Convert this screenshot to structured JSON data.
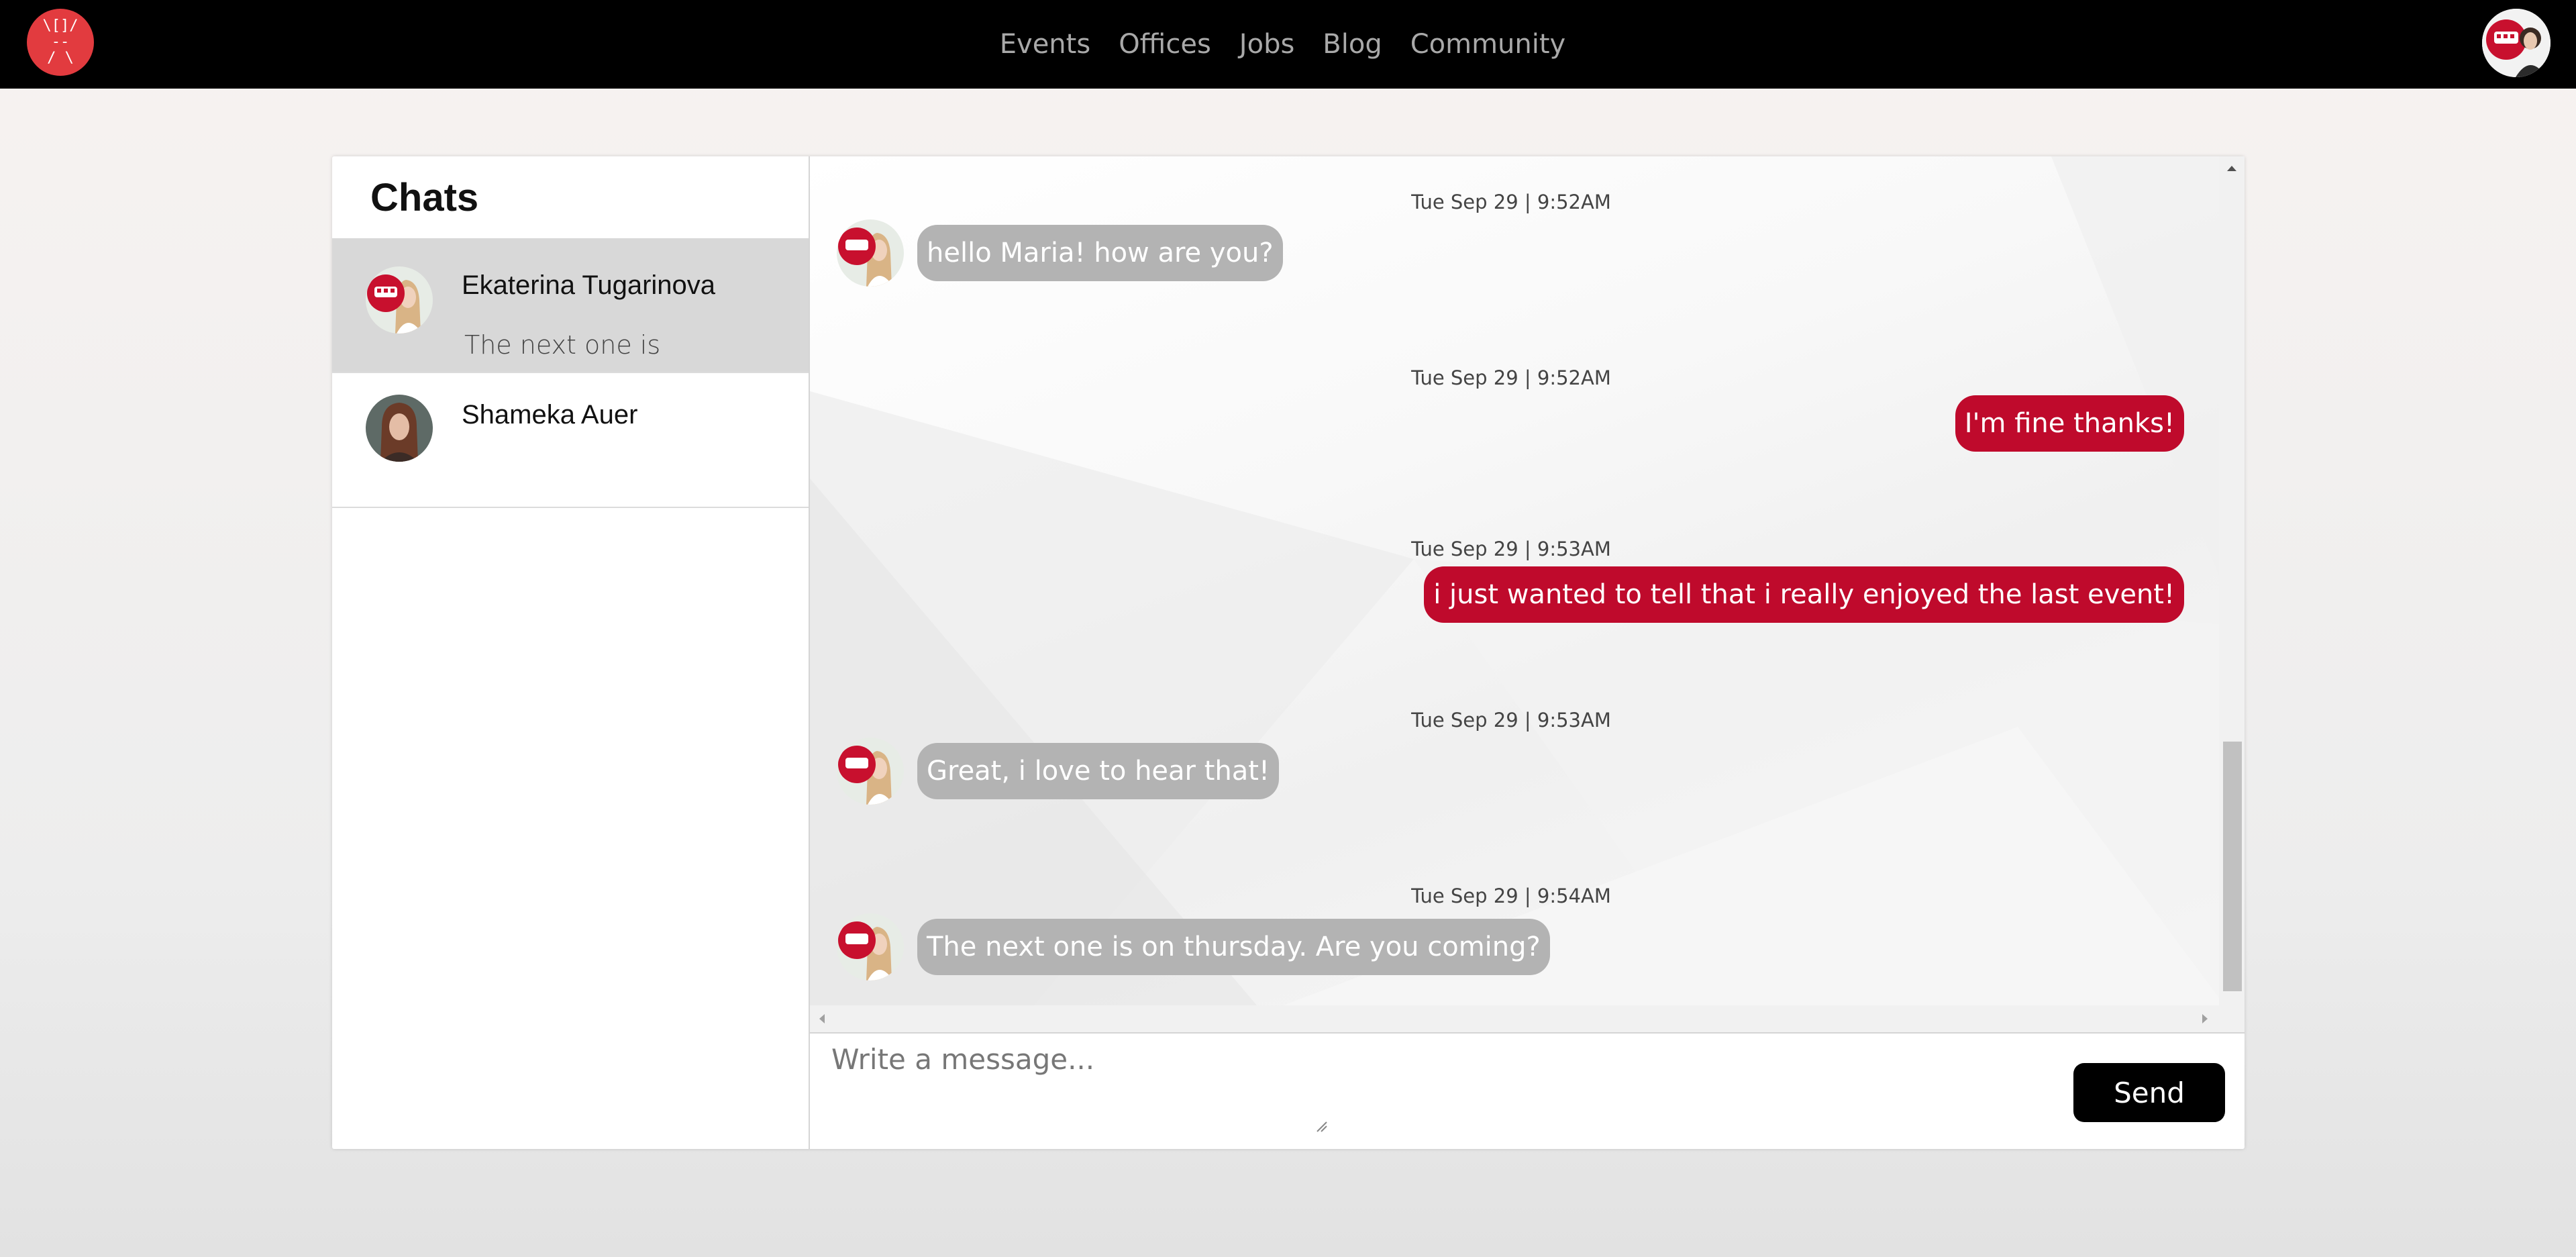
{
  "nav": {
    "logo_text": "\\[]/\n--\n/ \\",
    "links": [
      "Events",
      "Offices",
      "Jobs",
      "Blog",
      "Community"
    ]
  },
  "sidebar": {
    "title": "Chats",
    "contacts": [
      {
        "name": "Ekaterina Tugarinova",
        "preview": "The next one is",
        "active": true
      },
      {
        "name": "Shameka Auer",
        "preview": "",
        "active": false
      }
    ]
  },
  "messages": [
    {
      "time": "Tue Sep 29 | 9:52AM",
      "text": "hello Maria! how are you?",
      "direction": "in"
    },
    {
      "time": "Tue Sep 29 | 9:52AM",
      "text": "I'm fine thanks!",
      "direction": "out"
    },
    {
      "time": "Tue Sep 29 | 9:53AM",
      "text": "i just wanted to tell that i really enjoyed the last event!",
      "direction": "out"
    },
    {
      "time": "Tue Sep 29 | 9:53AM",
      "text": "Great, i love to hear that!",
      "direction": "in"
    },
    {
      "time": "Tue Sep 29 | 9:54AM",
      "text": "The next one is on thursday. Are you coming?",
      "direction": "in"
    }
  ],
  "composer": {
    "placeholder": "Write a message...",
    "send_label": "Send"
  },
  "colors": {
    "topbar": "#000000",
    "logo": "#e23b3f",
    "outgoing_bubble": "#bf0a2c",
    "incoming_bubble": "#b3b3b3",
    "active_contact": "#d8d8d8",
    "send_button": "#000000"
  },
  "icons": [
    "logo-icon",
    "scroll-up-icon",
    "scroll-down-icon",
    "scroll-left-icon",
    "scroll-right-icon",
    "resize-grip-icon"
  ]
}
